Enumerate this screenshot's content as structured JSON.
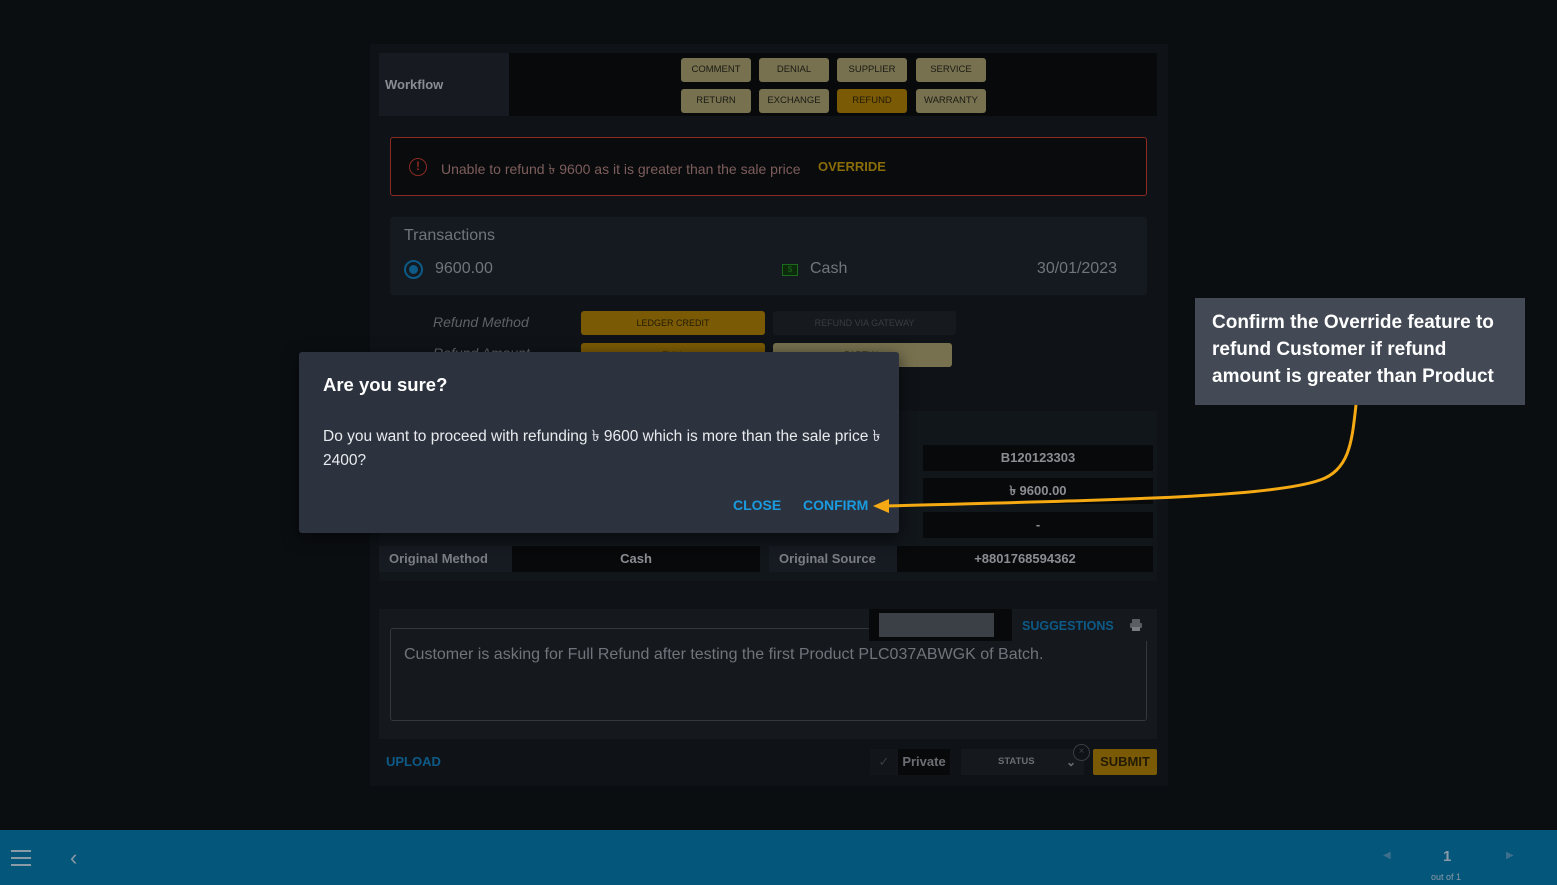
{
  "workflow": {
    "label": "Workflow",
    "buttons": [
      {
        "label": "COMMENT",
        "active": false
      },
      {
        "label": "DENIAL",
        "active": false
      },
      {
        "label": "SUPPLIER",
        "active": false
      },
      {
        "label": "SERVICE",
        "active": false
      },
      {
        "label": "RETURN",
        "active": false
      },
      {
        "label": "EXCHANGE",
        "active": false
      },
      {
        "label": "REFUND",
        "active": true
      },
      {
        "label": "WARRANTY",
        "active": false
      }
    ]
  },
  "error": {
    "icon": "alert-circle-icon",
    "message": "Unable to refund ৳ 9600 as it is greater than the sale price",
    "action": "OVERRIDE"
  },
  "transactions": {
    "title": "Transactions",
    "items": [
      {
        "amount": "9600.00",
        "method": "Cash",
        "method_icon": "cash-icon",
        "date": "30/01/2023",
        "selected": true
      }
    ]
  },
  "refund": {
    "method_label": "Refund Method",
    "method_options": [
      "LEDGER CREDIT",
      "REFUND VIA GATEWAY"
    ],
    "amount_label": "Refund Amount",
    "amount_options": [
      "FULL",
      "PARTIAL"
    ]
  },
  "details": {
    "rows": [
      {
        "right_value": "B120123303"
      },
      {
        "right_value": "৳ 9600.00"
      },
      {
        "right_value": "-"
      },
      {
        "left_label": "Original Method",
        "left_value": "Cash",
        "right_label": "Original Source",
        "right_value": "+8801768594362"
      }
    ]
  },
  "notes": {
    "text": "Customer is asking for Full Refund after testing the first Product PLC037ABWGK of Batch.",
    "suggestions_label": "SUGGESTIONS",
    "upload_label": "UPLOAD",
    "private_label": "Private",
    "status_placeholder": "STATUS",
    "submit_label": "SUBMIT"
  },
  "dialog": {
    "title": "Are you sure?",
    "body": "Do you want to proceed with refunding ৳ 9600 which is more than the sale price ৳ 2400?",
    "close_label": "CLOSE",
    "confirm_label": "CONFIRM"
  },
  "callout": {
    "text": "Confirm the Override feature to refund Customer if refund amount is greater than Product",
    "arrow_color": "#f5a912"
  },
  "pagination": {
    "current": "1",
    "total_label": "out of 1"
  },
  "colors": {
    "accent_gold": "#7a5a05",
    "link_blue": "#1a9be0",
    "error_red": "#8a2a22",
    "bottom_bar": "#04567a"
  }
}
